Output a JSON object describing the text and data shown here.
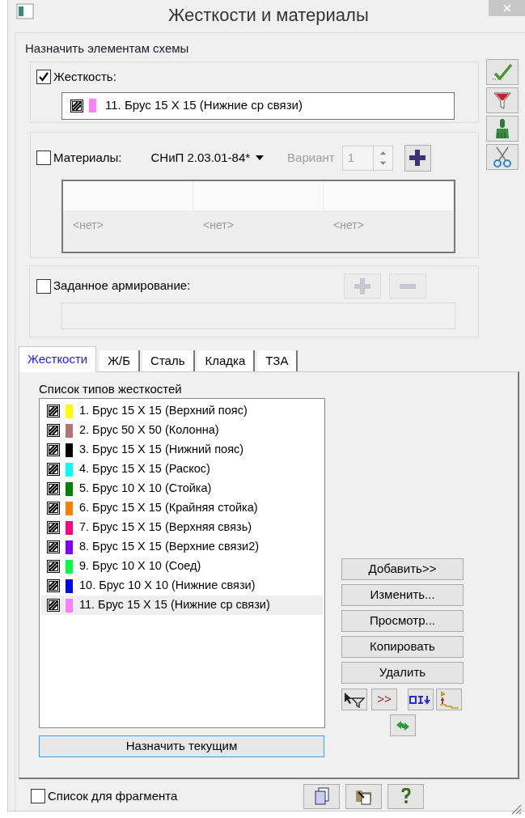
{
  "window": {
    "title": "Жесткости и материалы"
  },
  "assign_label": "Назначить элементам схемы",
  "stiffness": {
    "label": "Жесткость:",
    "checked": true,
    "value": "11. Брус 15 X 15 (Нижние ср связи)",
    "color": "#ff80ff"
  },
  "materials": {
    "label": "Материалы:",
    "checked": false,
    "norm": "СНиП 2.03.01-84*",
    "variant_label": "Вариант",
    "variant": "1",
    "cells": [
      "<нет>",
      "<нет>",
      "<нет>"
    ]
  },
  "reinforcement": {
    "label": "Заданное армирование:",
    "checked": false
  },
  "tabs": [
    {
      "label": "Жесткости",
      "selected": true
    },
    {
      "label": "Ж/Б",
      "selected": false
    },
    {
      "label": "Сталь",
      "selected": false
    },
    {
      "label": "Кладка",
      "selected": false
    },
    {
      "label": "ТЗА",
      "selected": false
    }
  ],
  "list_title": "Список типов жесткостей",
  "items": [
    {
      "text": "1. Брус 15 X 15 (Верхний пояс)",
      "color": "#ffff00",
      "selected": false
    },
    {
      "text": "2. Брус 50 X 50 (Колонна)",
      "color": "#b87070",
      "selected": false
    },
    {
      "text": "3. Брус 15 X 15 (Нижний пояс)",
      "color": "#000000",
      "selected": false
    },
    {
      "text": "4. Брус 15 X 15 (Раскос)",
      "color": "#00ffff",
      "selected": false
    },
    {
      "text": "5. Брус 10 X 10 (Стойка)",
      "color": "#008000",
      "selected": false
    },
    {
      "text": "6. Брус 15 X 15 (Крайняя стойка)",
      "color": "#ff8000",
      "selected": false
    },
    {
      "text": "7. Брус 15 X 15 (Верхняя связь)",
      "color": "#ff0080",
      "selected": false
    },
    {
      "text": "8. Брус 15 X 15 (Верхние связи2)",
      "color": "#8000ff",
      "selected": false
    },
    {
      "text": "9. Брус 10 X 10 (Соед)",
      "color": "#00ff40",
      "selected": false
    },
    {
      "text": "10. Брус 10 X 10 (Нижние связи)",
      "color": "#0000ff",
      "selected": false
    },
    {
      "text": "11. Брус 15 X 15 (Нижние ср связи)",
      "color": "#ff80ff",
      "selected": true
    }
  ],
  "action_buttons": [
    "Добавить>>",
    "Изменить...",
    "Просмотр...",
    "Копировать",
    "Удалить"
  ],
  "more_button": ">>",
  "assign_button": "Назначить текущим",
  "fragment": {
    "label": "Список для фрагмента",
    "checked": false
  }
}
